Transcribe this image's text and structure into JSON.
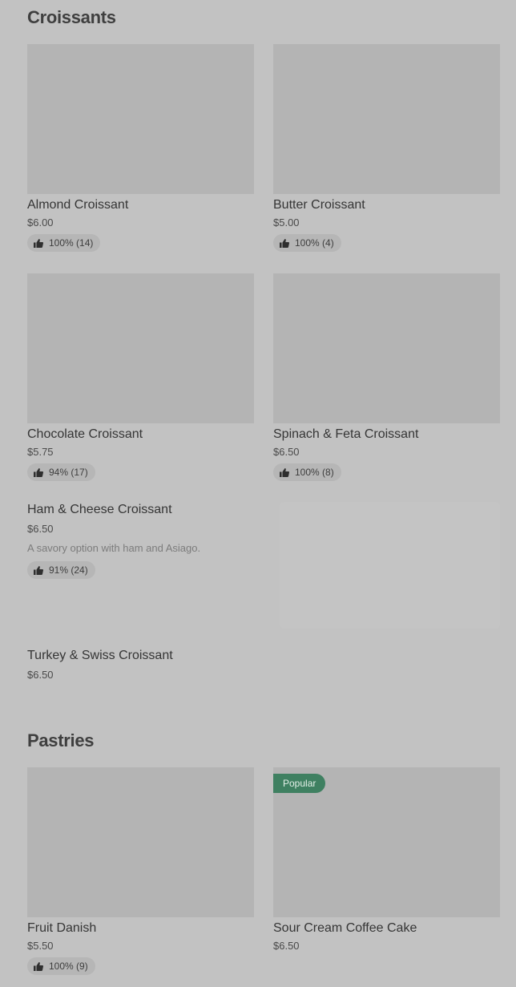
{
  "sections": {
    "croissants": {
      "title": "Croissants",
      "items": [
        {
          "name": "Almond Croissant",
          "price": "$6.00",
          "rating": "100% (14)"
        },
        {
          "name": "Butter Croissant",
          "price": "$5.00",
          "rating": "100% (4)"
        },
        {
          "name": "Chocolate Croissant",
          "price": "$5.75",
          "rating": "94% (17)"
        },
        {
          "name": "Spinach & Feta Croissant",
          "price": "$6.50",
          "rating": "100% (8)"
        },
        {
          "name": "Ham & Cheese Croissant",
          "price": "$6.50",
          "description": "A savory option with ham and Asiago.",
          "rating": "91% (24)"
        },
        {
          "name": "Turkey & Swiss Croissant",
          "price": "$6.50"
        }
      ]
    },
    "pastries": {
      "title": "Pastries",
      "items": [
        {
          "name": "Fruit Danish",
          "price": "$5.50",
          "rating": "100% (9)"
        },
        {
          "name": "Sour Cream Coffee Cake",
          "price": "$6.50",
          "badge": "Popular"
        }
      ]
    }
  },
  "icons": {
    "rating": "thumbs-up-icon"
  },
  "colors": {
    "badge": "#3f8061",
    "background": "#c2c2c2",
    "thumbnail": "#b4b4b4"
  }
}
